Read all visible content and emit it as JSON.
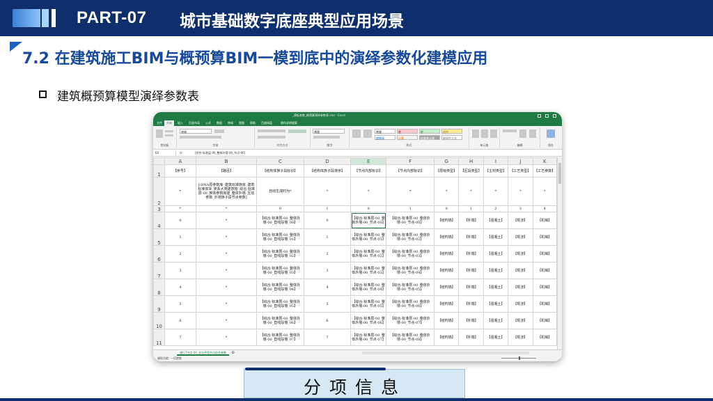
{
  "header": {
    "part_label": "PART-07",
    "title": "城市基础数字底座典型应用场景"
  },
  "section": {
    "title": "7.2 在建筑施工BIM与概预算BIM一模到底中的演绎参数化建模应用"
  },
  "bullet": {
    "text": "建筑概预算模型演绎参数表"
  },
  "excel": {
    "window_title": "_模板参数_概预算演绎参数表.xlsx - Excel",
    "tabs": [
      "文件",
      "开始",
      "插入",
      "页面布局",
      "公式",
      "数据",
      "审阅",
      "视图",
      "帮助",
      "百度网盘",
      "操作说明搜索"
    ],
    "active_tab": "开始",
    "ribbon_groups": [
      "剪贴板",
      "字体",
      "对齐方式",
      "数字",
      "样式",
      "单元格",
      "编辑",
      "保存"
    ],
    "styles": [
      "常规",
      "差",
      "好",
      "适中",
      "超链接",
      "计算",
      "检查单元格",
      "解释性文本"
    ],
    "font_name": "宋体",
    "number_format": "常规",
    "cell_ref": "E4",
    "formula": "[综合-标准层-00_整体外墙-00_节点-00]",
    "col_letters": [
      "A",
      "B",
      "C",
      "D",
      "E",
      "F",
      "G",
      "H",
      "I",
      "J",
      "K"
    ],
    "header_row": [
      "【序号】",
      "【路径】",
      "【结构体族子段标识】",
      "【结构体族子段排序】",
      "【节点内部标识】",
      "【节点内部标识】",
      "【层级类型】",
      "【区段类型】",
      "【主材类型】",
      "【工艺类型】",
      "【工艺参数】"
    ],
    "row2": [
      "*",
      "[\\DNA原参数库_建筑标准族库_建筑标准体块_类系大类建筑物_综合-标准层-00_族体参数库建_整体外墙_互动参数_外墙族子段节点参数]",
      "自动生成时为*",
      "*",
      "*",
      "*",
      "*",
      "*",
      "*",
      "*",
      "*"
    ],
    "row3": [
      "*",
      "*",
      "0",
      "1",
      "0",
      "1",
      "0",
      "1",
      "2",
      "3",
      "4"
    ],
    "data_rows": [
      {
        "seq": "0",
        "path": "*",
        "c": "【综合-标准层-00_整体外墙-00_直线段墙_00】",
        "d": "0",
        "e": "【综合-标准层-00_整体外墙-00_节点-00】",
        "f": "【综合-标准层-00_整体外墙-00_节点-00】",
        "g": "【结构墙】",
        "h": "【外墙】",
        "i": "【混凝土】",
        "j": "【现浇】",
        "k": "【机械】"
      },
      {
        "seq": "1",
        "path": "*",
        "c": "【综合-标准层-00_整体外墙-00_直线段墙_01】",
        "d": "1",
        "e": "【综合-标准层-00_整体外墙-00_节点-01】",
        "f": "【综合-标准层-00_整体外墙-00_节点-02】",
        "g": "【结构墙】",
        "h": "【外墙】",
        "i": "【混凝土】",
        "j": "【现浇】",
        "k": "【机械】"
      },
      {
        "seq": "2",
        "path": "*",
        "c": "【综合-标准层-00_整体外墙-00_直线段墙_02】",
        "d": "2",
        "e": "【综合-标准层-00_整体外墙-00_节点-02】",
        "f": "【综合-标准层-00_整体外墙-00_节点-03】",
        "g": "【结构墙】",
        "h": "【外墙】",
        "i": "【混凝土】",
        "j": "【现浇】",
        "k": "【机械】"
      },
      {
        "seq": "3",
        "path": "*",
        "c": "【综合-标准层-00_整体外墙-00_直线段墙_03】",
        "d": "3",
        "e": "【综合-标准层-00_整体外墙-00_节点-03】",
        "f": "【综合-标准层-00_整体外墙-00_节点-04】",
        "g": "【结构墙】",
        "h": "【外墙】",
        "i": "【混凝土】",
        "j": "【现浇】",
        "k": "【机械】"
      },
      {
        "seq": "4",
        "path": "*",
        "c": "【综合-标准层-00_整体外墙-00_直线段墙_04】",
        "d": "4",
        "e": "【综合-标准层-00_整体外墙-00_节点-04】",
        "f": "【综合-标准层-00_整体外墙-00_节点-05】",
        "g": "【结构墙】",
        "h": "【外墙】",
        "i": "【混凝土】",
        "j": "【现浇】",
        "k": "【机械】"
      },
      {
        "seq": "5",
        "path": "*",
        "c": "【综合-标准层-00_整体外墙-00_直线段墙_05】",
        "d": "5",
        "e": "【综合-标准层-00_整体外墙-00_节点-05】",
        "f": "【综合-标准层-00_整体外墙-00_节点-06】",
        "g": "【结构墙】",
        "h": "【外墙】",
        "i": "【混凝土】",
        "j": "【现浇】",
        "k": "【机械】"
      },
      {
        "seq": "6",
        "path": "*",
        "c": "【综合-标准层-00_整体外墙-00_直线段墙_06】",
        "d": "6",
        "e": "【综合-标准层-00_整体外墙-00_节点-06】",
        "f": "【综合-标准层-00_整体外墙-00_节点-07】",
        "g": "【结构墙】",
        "h": "【外墙】",
        "i": "【混凝土】",
        "j": "【现浇】",
        "k": "【机械】"
      },
      {
        "seq": "7",
        "path": "*",
        "c": "【综合-标准层-00_整体外墙-00_直线段墙_07】",
        "d": "7",
        "e": "【综合-标准层-00_整体外墙-00_节点-07】",
        "f": "【综合-标准层-00_整体外墙-00_节点-08】",
        "g": "【结构墙】",
        "h": "【外墙】",
        "i": "【混凝土】",
        "j": "【现浇】",
        "k": "【机械】"
      }
    ],
    "sheet_tab": "建行T节点-00_非次序墙节点综合参数",
    "status": "辅助功能: 一切就绪"
  },
  "footer_label": {
    "text": "分项信息"
  },
  "colors": {
    "navy": "#0e2f6b",
    "heading_blue": "#174a9c",
    "excel_green": "#1f7a44",
    "info_box": "#d6e8f3"
  }
}
